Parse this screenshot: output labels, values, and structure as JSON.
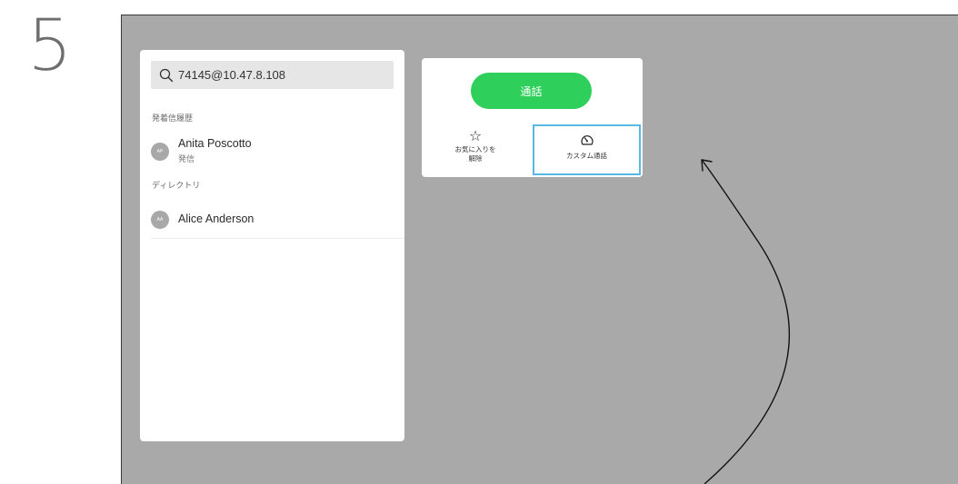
{
  "step": {
    "number": "5"
  },
  "search": {
    "value": "74145@10.47.8.108"
  },
  "sections": {
    "recents_header": "発着信履歴",
    "directory_header": "ディレクトリ"
  },
  "recents": [
    {
      "initials": "AP",
      "name": "Anita Poscotto",
      "status": "発信"
    }
  ],
  "directory": [
    {
      "initials": "AA",
      "name": "Alice Anderson"
    }
  ],
  "actions": {
    "call_label": "通話",
    "unfavorite_line1": "お気に入りを",
    "unfavorite_line2": "解除",
    "custom_call_label": "カスタム通話"
  },
  "colors": {
    "call_button": "#2fcf5b",
    "highlight_border": "#58b8e6",
    "screen_background": "#a9a9a9"
  },
  "icons": {
    "search": "search-icon",
    "favorite": "star-icon",
    "custom_call": "gauge-icon"
  }
}
